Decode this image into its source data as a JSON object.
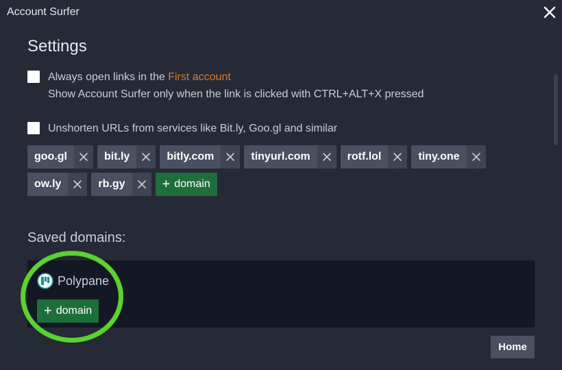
{
  "window": {
    "title": "Account Surfer",
    "close_icon": "close-icon"
  },
  "settings": {
    "title": "Settings",
    "always_open": {
      "checked": false,
      "label_prefix": "Always open links in the ",
      "label_accent": "First account",
      "description": "Show Account Surfer only when the link is clicked with CTRL+ALT+X pressed"
    },
    "unshorten": {
      "checked": false,
      "label": "Unshorten URLs from services like Bit.ly, Goo.gl and similar"
    },
    "domains": [
      "goo.gl",
      "bit.ly",
      "bitly.com",
      "tinyurl.com",
      "rotf.lol",
      "tiny.one",
      "ow.ly",
      "rb.gy"
    ],
    "add_domain_label": "domain"
  },
  "saved": {
    "title": "Saved domains:",
    "items": [
      {
        "label": "Polypane",
        "icon": "polypane-icon"
      }
    ],
    "add_domain_label": "domain"
  },
  "footer": {
    "home_label": "Home"
  },
  "colors": {
    "accent": "#d97a28",
    "add_button": "#1e6e3b",
    "highlight": "#5bd22e"
  }
}
